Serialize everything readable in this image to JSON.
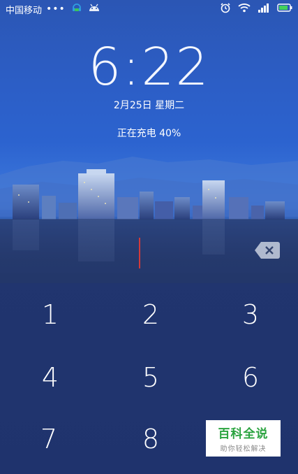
{
  "status_bar": {
    "carrier": "中国移动",
    "dots": "•••",
    "icons_left": [
      "headset-message-icon",
      "android-icon"
    ],
    "icons_right": [
      "alarm-icon",
      "wifi-icon",
      "signal-icon",
      "battery-icon"
    ]
  },
  "lock": {
    "time": "6:22",
    "date": "2月25日 星期二",
    "charging": "正在充电 40%"
  },
  "keypad": {
    "keys": [
      "1",
      "2",
      "3",
      "4",
      "5",
      "6",
      "7",
      "8"
    ]
  },
  "watermark": {
    "title": "百科全说",
    "subtitle": "助你轻松解决"
  },
  "colors": {
    "accent_green": "#2aa33f",
    "cursor_red": "#d23a3a"
  }
}
